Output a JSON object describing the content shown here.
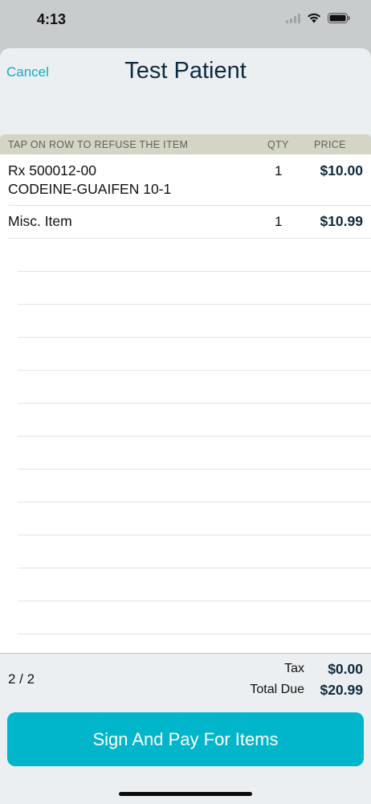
{
  "status_bar": {
    "time": "4:13",
    "icons": [
      "signal-icon",
      "wifi-icon",
      "battery-icon"
    ]
  },
  "nav": {
    "cancel_label": "Cancel",
    "title": "Test Patient"
  },
  "table": {
    "header": {
      "description": "TAP ON ROW TO REFUSE THE ITEM",
      "qty": "QTY",
      "price": "PRICE"
    },
    "rows": [
      {
        "line1": "Rx 500012-00",
        "line2": "CODEINE-GUAIFEN 10-1",
        "qty": "1",
        "price": "$10.00"
      },
      {
        "line1": "Misc. Item",
        "line2": "",
        "qty": "1",
        "price": "$10.99"
      }
    ]
  },
  "footer": {
    "page_indicator": "2 / 2",
    "tax_label": "Tax",
    "tax_value": "$0.00",
    "total_label": "Total Due",
    "total_value": "$20.99"
  },
  "pay_button_label": "Sign And Pay For Items",
  "colors": {
    "accent": "#01b5cb",
    "link": "#12aac7",
    "title": "#0e2b3e",
    "header_bg": "#d5d5c6"
  }
}
